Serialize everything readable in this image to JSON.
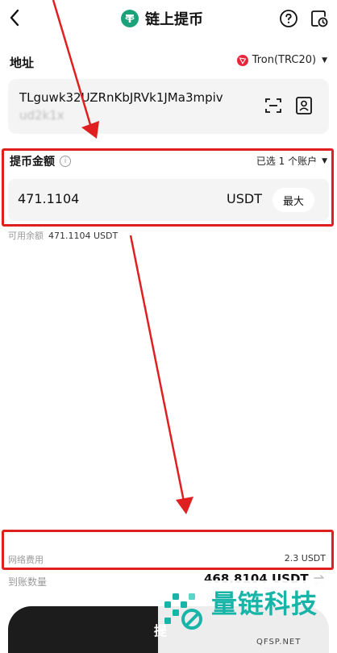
{
  "header": {
    "title": "链上提币",
    "back_icon": "chevron-left-icon",
    "help_icon": "question-circle-icon",
    "history_icon": "history-doc-icon"
  },
  "address": {
    "label": "地址",
    "network": "Tron(TRC20)",
    "value_line1": "TLguwk32UZRnKbJRVk1JMa3mpiv",
    "value_line2": "ud2k1x"
  },
  "amount": {
    "label": "提币金额",
    "account_select": "已选 1 个账户",
    "value": "471.1104",
    "unit": "USDT",
    "max_label": "最大",
    "available_label": "可用余额",
    "available_value": "471.1104 USDT"
  },
  "fees": {
    "fee_label": "网络费用",
    "fee_value": "2.3 USDT",
    "receive_label": "到账数量",
    "receive_value": "468.8104 USDT"
  },
  "submit": {
    "label": "提"
  },
  "watermark": {
    "text": "量链科技",
    "url": "QFSP.NET"
  },
  "colors": {
    "highlight": "#e02020",
    "brand_tether": "#1ba27a",
    "tron": "#e8253b",
    "watermark": "#18b4a8"
  }
}
